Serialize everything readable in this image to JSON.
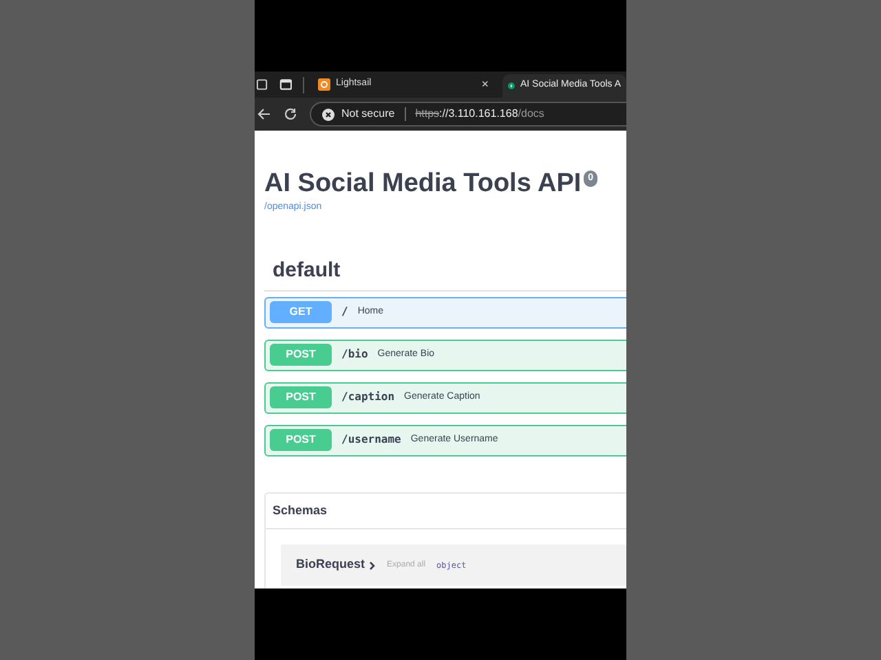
{
  "browser": {
    "tabs": [
      {
        "label": "Lightsail",
        "selected": false,
        "close": "×"
      },
      {
        "label": "AI Social Media Tools A",
        "selected": true
      }
    ],
    "address": {
      "security": "Not secure",
      "scheme": "https",
      "host": "://3.110.161.168",
      "path": "/docs"
    }
  },
  "page": {
    "title": "AI Social Media Tools API",
    "version": "0",
    "spec_link": "/openapi.json",
    "section": "default",
    "operations": [
      {
        "method": "GET",
        "path": "/",
        "summary": "Home"
      },
      {
        "method": "POST",
        "path": "/bio",
        "summary": "Generate Bio"
      },
      {
        "method": "POST",
        "path": "/caption",
        "summary": "Generate Caption"
      },
      {
        "method": "POST",
        "path": "/username",
        "summary": "Generate Username"
      }
    ],
    "schemas": {
      "title": "Schemas",
      "items": [
        {
          "name": "BioRequest",
          "expand": "Expand all",
          "type": "object"
        }
      ]
    }
  }
}
